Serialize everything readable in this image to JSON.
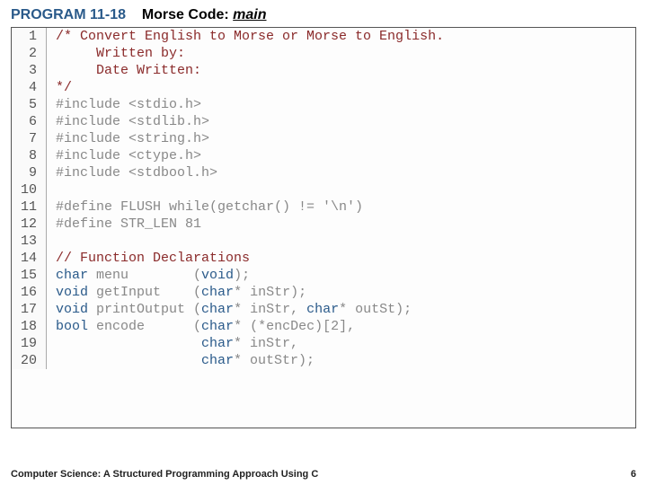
{
  "header": {
    "program_label": "PROGRAM 11-18",
    "title_prefix": "Morse Code: ",
    "title_italic": "main"
  },
  "code": {
    "lines": [
      {
        "n": 1,
        "segs": [
          {
            "cls": "c-comment",
            "t": "/* Convert English to Morse or Morse to English."
          }
        ]
      },
      {
        "n": 2,
        "segs": [
          {
            "cls": "c-comment",
            "t": "     Written by:"
          }
        ]
      },
      {
        "n": 3,
        "segs": [
          {
            "cls": "c-comment",
            "t": "     Date Written:"
          }
        ]
      },
      {
        "n": 4,
        "segs": [
          {
            "cls": "c-comment",
            "t": "*/"
          }
        ]
      },
      {
        "n": 5,
        "segs": [
          {
            "cls": "c-pre",
            "t": "#include <stdio.h>"
          }
        ]
      },
      {
        "n": 6,
        "segs": [
          {
            "cls": "c-pre",
            "t": "#include <stdlib.h>"
          }
        ]
      },
      {
        "n": 7,
        "segs": [
          {
            "cls": "c-pre",
            "t": "#include <string.h>"
          }
        ]
      },
      {
        "n": 8,
        "segs": [
          {
            "cls": "c-pre",
            "t": "#include <ctype.h>"
          }
        ]
      },
      {
        "n": 9,
        "segs": [
          {
            "cls": "c-pre",
            "t": "#include <stdbool.h>"
          }
        ]
      },
      {
        "n": 10,
        "segs": [
          {
            "cls": "",
            "t": ""
          }
        ]
      },
      {
        "n": 11,
        "segs": [
          {
            "cls": "c-pre",
            "t": "#define FLUSH while(getchar() != '\\n')"
          }
        ]
      },
      {
        "n": 12,
        "segs": [
          {
            "cls": "c-pre",
            "t": "#define STR_LEN 81"
          }
        ]
      },
      {
        "n": 13,
        "segs": [
          {
            "cls": "",
            "t": ""
          }
        ]
      },
      {
        "n": 14,
        "segs": [
          {
            "cls": "c-comment",
            "t": "// Function Declarations"
          }
        ]
      },
      {
        "n": 15,
        "segs": [
          {
            "cls": "c-blue",
            "t": "char"
          },
          {
            "cls": "",
            "t": " menu        ("
          },
          {
            "cls": "c-blue",
            "t": "void"
          },
          {
            "cls": "",
            "t": ");"
          }
        ]
      },
      {
        "n": 16,
        "segs": [
          {
            "cls": "c-blue",
            "t": "void"
          },
          {
            "cls": "",
            "t": " getInput    ("
          },
          {
            "cls": "c-blue",
            "t": "char"
          },
          {
            "cls": "",
            "t": "* inStr);"
          }
        ]
      },
      {
        "n": 17,
        "segs": [
          {
            "cls": "c-blue",
            "t": "void"
          },
          {
            "cls": "",
            "t": " printOutput ("
          },
          {
            "cls": "c-blue",
            "t": "char"
          },
          {
            "cls": "",
            "t": "* inStr, "
          },
          {
            "cls": "c-blue",
            "t": "char"
          },
          {
            "cls": "",
            "t": "* outSt);"
          }
        ]
      },
      {
        "n": 18,
        "segs": [
          {
            "cls": "c-blue",
            "t": "bool"
          },
          {
            "cls": "",
            "t": " encode      ("
          },
          {
            "cls": "c-blue",
            "t": "char"
          },
          {
            "cls": "",
            "t": "* (*encDec)[2],"
          }
        ]
      },
      {
        "n": 19,
        "segs": [
          {
            "cls": "",
            "t": "                  "
          },
          {
            "cls": "c-blue",
            "t": "char"
          },
          {
            "cls": "",
            "t": "* inStr,"
          }
        ]
      },
      {
        "n": 20,
        "segs": [
          {
            "cls": "",
            "t": "                  "
          },
          {
            "cls": "c-blue",
            "t": "char"
          },
          {
            "cls": "",
            "t": "* outStr);"
          }
        ]
      }
    ]
  },
  "footer": {
    "text": "Computer Science: A Structured Programming Approach Using C",
    "page": "6"
  }
}
